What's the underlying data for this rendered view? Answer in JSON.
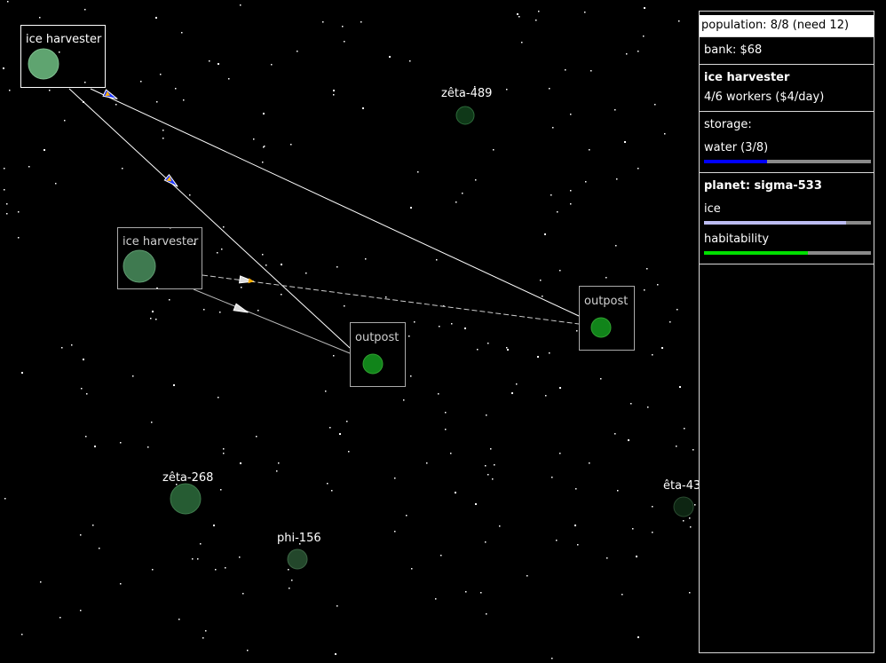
{
  "panel": {
    "population": "population: 8/8 (need 12)",
    "bank": "bank: $68",
    "building": {
      "name": "ice harvester",
      "workers": "4/6 workers ($4/day)"
    },
    "storage": {
      "title": "storage:",
      "items": [
        {
          "label": "water (3/8)",
          "fraction": 0.375,
          "color": "#0000ff"
        }
      ]
    },
    "planet": {
      "title": "planet: sigma-533",
      "stats": [
        {
          "label": "ice",
          "fraction": 0.85,
          "color": "#bcbcf2"
        },
        {
          "label": "habitability",
          "fraction": 0.62,
          "color": "#00e000"
        }
      ]
    }
  },
  "map": {
    "buildings": [
      {
        "id": "b1",
        "label": "ice harvester",
        "selected": true
      },
      {
        "id": "b2",
        "label": "ice harvester",
        "selected": false
      },
      {
        "id": "b3",
        "label": "outpost",
        "selected": false
      },
      {
        "id": "b4",
        "label": "outpost",
        "selected": false
      }
    ],
    "planets": [
      {
        "id": "p1",
        "label": "zêta-489"
      },
      {
        "id": "p2",
        "label": "zêta-268"
      },
      {
        "id": "p3",
        "label": "phi-156"
      },
      {
        "id": "p4",
        "label": "êta-43"
      }
    ]
  }
}
